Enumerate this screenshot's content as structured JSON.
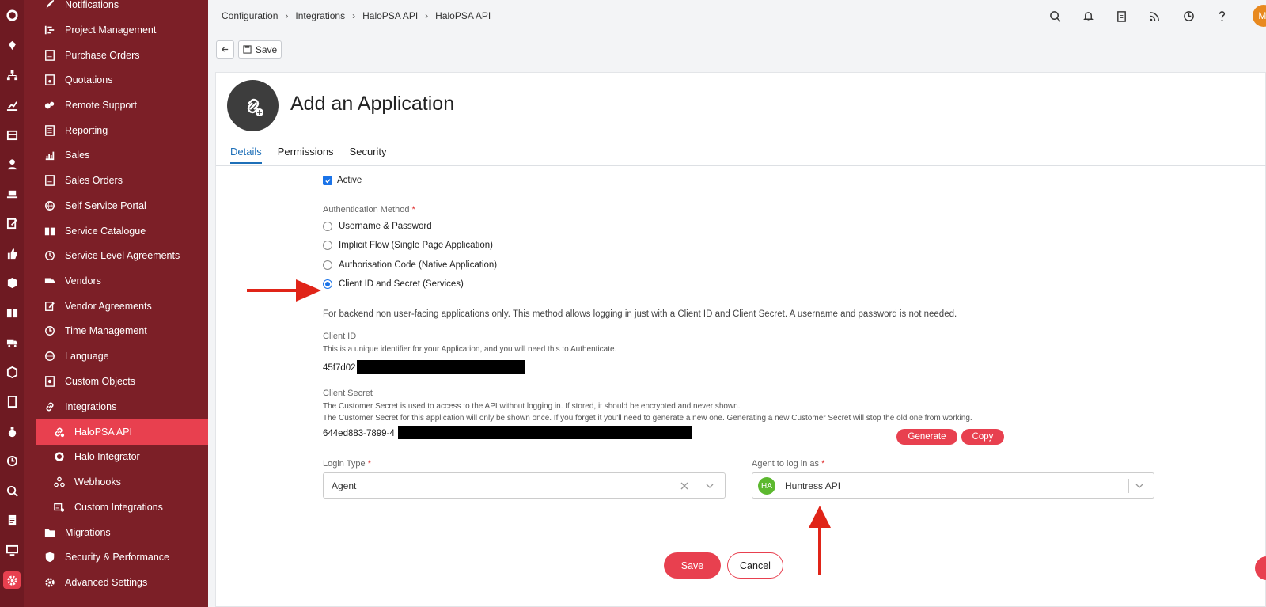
{
  "breadcrumb": [
    "Configuration",
    "Integrations",
    "HaloPSA API",
    "HaloPSA API"
  ],
  "user_initials": "MI",
  "toolbar": {
    "save_label": "Save"
  },
  "sidebar": {
    "items": [
      {
        "label": "Notifications",
        "icon": "rocket-icon"
      },
      {
        "label": "Project Management",
        "icon": "project-icon"
      },
      {
        "label": "Purchase Orders",
        "icon": "purchase-order-icon"
      },
      {
        "label": "Quotations",
        "icon": "quotation-icon"
      },
      {
        "label": "Remote Support",
        "icon": "remote-support-icon"
      },
      {
        "label": "Reporting",
        "icon": "report-icon"
      },
      {
        "label": "Sales",
        "icon": "sales-chart-icon"
      },
      {
        "label": "Sales Orders",
        "icon": "sales-order-icon"
      },
      {
        "label": "Self Service Portal",
        "icon": "globe-icon"
      },
      {
        "label": "Service Catalogue",
        "icon": "book-icon"
      },
      {
        "label": "Service Level Agreements",
        "icon": "sla-clock-icon"
      },
      {
        "label": "Vendors",
        "icon": "truck-icon"
      },
      {
        "label": "Vendor Agreements",
        "icon": "edit-icon"
      },
      {
        "label": "Time Management",
        "icon": "clock-icon"
      },
      {
        "label": "Language",
        "icon": "globe-icon"
      },
      {
        "label": "Custom Objects",
        "icon": "custom-object-icon"
      },
      {
        "label": "Integrations",
        "icon": "link-icon"
      },
      {
        "label": "HaloPSA API",
        "icon": "api-icon"
      },
      {
        "label": "Halo Integrator",
        "icon": "halo-ring-icon"
      },
      {
        "label": "Webhooks",
        "icon": "webhook-icon"
      },
      {
        "label": "Custom Integrations",
        "icon": "custom-integration-icon"
      },
      {
        "label": "Migrations",
        "icon": "folder-icon"
      },
      {
        "label": "Security & Performance",
        "icon": "shield-icon"
      },
      {
        "label": "Advanced Settings",
        "icon": "gear-icon"
      }
    ]
  },
  "page": {
    "title": "Add an Application",
    "tabs": [
      "Details",
      "Permissions",
      "Security"
    ]
  },
  "form": {
    "active_label": "Active",
    "auth_method_label": "Authentication Method",
    "auth_options": [
      "Username & Password",
      "Implicit Flow (Single Page Application)",
      "Authorisation Code (Native Application)",
      "Client ID and Secret (Services)"
    ],
    "selected_auth_option": "Client ID and Secret (Services)",
    "auth_description": "For backend non user-facing applications only. This method allows logging in just with a Client ID and Client Secret. A username and password is not needed.",
    "client_id_label": "Client ID",
    "client_id_help": "This is a unique identifier for your Application, and you will need this to Authenticate.",
    "client_id_value": "45f7d02",
    "client_secret_label": "Client Secret",
    "client_secret_help1": "The Customer Secret is used to access to the API without logging in. If stored, it should be encrypted and never shown.",
    "client_secret_help2": "The Customer Secret for this application will only be shown once. If you forget it you'll need to generate a new one. Generating a new Customer Secret will stop the old one from working.",
    "client_secret_value": "644ed883-7899-4",
    "generate_label": "Generate",
    "copy_label": "Copy",
    "login_type_label": "Login Type",
    "login_type_value": "Agent",
    "agent_label": "Agent to log in as",
    "agent_initials": "HA",
    "agent_value": "Huntress API",
    "save_label": "Save",
    "cancel_label": "Cancel"
  },
  "colors": {
    "sidebar_bg": "#7c1f27",
    "rail_bg": "#6e1a22",
    "accent": "#e8404f",
    "tab_active": "#1d6fb8",
    "annotation_arrow": "#e02418"
  }
}
